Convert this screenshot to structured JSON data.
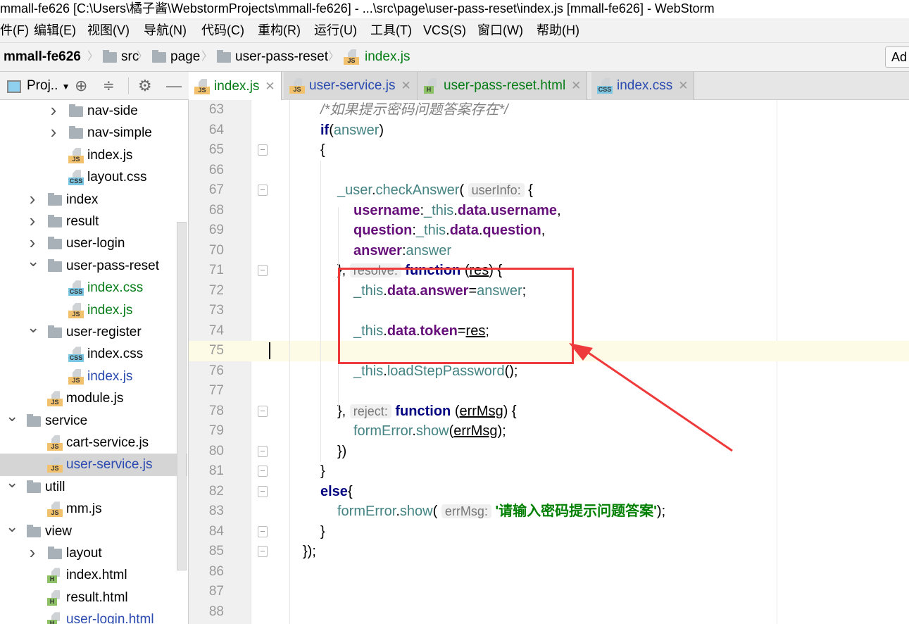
{
  "window": {
    "title": "mmall-fe626 [C:\\Users\\橘子酱\\WebstormProjects\\mmall-fe626] - ...\\src\\page\\user-pass-reset\\index.js [mmall-fe626] - WebStorm"
  },
  "menu": [
    "件(F)",
    "编辑(E)",
    "视图(V)",
    "导航(N)",
    "代码(C)",
    "重构(R)",
    "运行(U)",
    "工具(T)",
    "VCS(S)",
    "窗口(W)",
    "帮助(H)"
  ],
  "breadcrumb": {
    "project": "mmall-fe626",
    "items": [
      "src",
      "page",
      "user-pass-reset"
    ],
    "file": "index.js",
    "add_button": "Ad"
  },
  "project_panel": {
    "label": "Proj.."
  },
  "tabs": [
    {
      "label": "index.js",
      "type": "js",
      "color": "#067d17",
      "active": true
    },
    {
      "label": "user-service.js",
      "type": "js",
      "color": "#2a4ab0"
    },
    {
      "label": "user-pass-reset.html",
      "type": "html",
      "color": "#067d17"
    },
    {
      "label": "index.css",
      "type": "css",
      "color": "#2a4ab0"
    }
  ],
  "tree": [
    {
      "label": "nav-side",
      "kind": "folder",
      "level": 3,
      "state": "collapsed"
    },
    {
      "label": "nav-simple",
      "kind": "folder",
      "level": 3,
      "state": "collapsed"
    },
    {
      "label": "index.js",
      "kind": "js",
      "level": 3
    },
    {
      "label": "layout.css",
      "kind": "css",
      "level": 3
    },
    {
      "label": "index",
      "kind": "folder",
      "level": 2,
      "state": "collapsed"
    },
    {
      "label": "result",
      "kind": "folder",
      "level": 2,
      "state": "collapsed"
    },
    {
      "label": "user-login",
      "kind": "folder",
      "level": 2,
      "state": "collapsed"
    },
    {
      "label": "user-pass-reset",
      "kind": "folder",
      "level": 2,
      "state": "expanded"
    },
    {
      "label": "index.css",
      "kind": "css",
      "level": 3,
      "color": "#067d17"
    },
    {
      "label": "index.js",
      "kind": "js",
      "level": 3,
      "color": "#067d17"
    },
    {
      "label": "user-register",
      "kind": "folder",
      "level": 2,
      "state": "expanded"
    },
    {
      "label": "index.css",
      "kind": "css",
      "level": 3
    },
    {
      "label": "index.js",
      "kind": "js",
      "level": 3,
      "color": "#2a4ab0"
    },
    {
      "label": "module.js",
      "kind": "js",
      "level": 2
    },
    {
      "label": "service",
      "kind": "folder",
      "level": 1,
      "state": "expanded"
    },
    {
      "label": "cart-service.js",
      "kind": "js",
      "level": 2
    },
    {
      "label": "user-service.js",
      "kind": "js",
      "level": 2,
      "color": "#2a4ab0",
      "selected": true
    },
    {
      "label": "utill",
      "kind": "folder",
      "level": 1,
      "state": "expanded"
    },
    {
      "label": "mm.js",
      "kind": "js",
      "level": 2
    },
    {
      "label": "view",
      "kind": "folder",
      "level": 1,
      "state": "expanded"
    },
    {
      "label": "layout",
      "kind": "folder",
      "level": 2,
      "state": "collapsed"
    },
    {
      "label": "index.html",
      "kind": "html",
      "level": 2
    },
    {
      "label": "result.html",
      "kind": "html",
      "level": 2
    },
    {
      "label": "user-login.html",
      "kind": "html",
      "level": 2,
      "color": "#2a4ab0"
    }
  ],
  "editor": {
    "current_line": 75,
    "lines": [
      {
        "n": 63,
        "indent": 2,
        "tokens": [
          [
            "/*如果提示密码问题答案存在*/",
            "cm"
          ]
        ]
      },
      {
        "n": 64,
        "indent": 2,
        "tokens": [
          [
            "if",
            "kw"
          ],
          [
            "(",
            ""
          ],
          [
            "answer",
            "id"
          ],
          [
            ")",
            ""
          ]
        ]
      },
      {
        "n": 65,
        "indent": 2,
        "fold": true,
        "tokens": [
          [
            "{",
            ""
          ]
        ]
      },
      {
        "n": 66,
        "indent": 0,
        "tokens": []
      },
      {
        "n": 67,
        "indent": 3,
        "fold": true,
        "tokens": [
          [
            "_user",
            "id"
          ],
          [
            ".",
            ""
          ],
          [
            "checkAnswer",
            "fn"
          ],
          [
            "( ",
            ""
          ],
          [
            "userInfo:",
            "hint"
          ],
          [
            " {",
            ""
          ]
        ]
      },
      {
        "n": 68,
        "indent": 4,
        "tokens": [
          [
            "username",
            "pr"
          ],
          [
            ":",
            ""
          ],
          [
            "_this",
            "id"
          ],
          [
            ".",
            ""
          ],
          [
            "data",
            "pr"
          ],
          [
            ".",
            ""
          ],
          [
            "username",
            "pr"
          ],
          [
            ",",
            ""
          ]
        ]
      },
      {
        "n": 69,
        "indent": 4,
        "tokens": [
          [
            "question",
            "pr"
          ],
          [
            ":",
            ""
          ],
          [
            "_this",
            "id"
          ],
          [
            ".",
            ""
          ],
          [
            "data",
            "pr"
          ],
          [
            ".",
            ""
          ],
          [
            "question",
            "pr"
          ],
          [
            ",",
            ""
          ]
        ]
      },
      {
        "n": 70,
        "indent": 4,
        "tokens": [
          [
            "answer",
            "pr"
          ],
          [
            ":",
            ""
          ],
          [
            "answer",
            "id"
          ]
        ]
      },
      {
        "n": 71,
        "indent": 3,
        "fold": true,
        "tokens": [
          [
            "}, ",
            ""
          ],
          [
            "resolve:",
            "hint"
          ],
          [
            " ",
            ""
          ],
          [
            "function",
            "kw"
          ],
          [
            " (",
            ""
          ],
          [
            "res",
            "ul"
          ],
          [
            ") {",
            ""
          ]
        ]
      },
      {
        "n": 72,
        "indent": 4,
        "tokens": [
          [
            "_this",
            "id"
          ],
          [
            ".",
            ""
          ],
          [
            "data",
            "pr"
          ],
          [
            ".",
            ""
          ],
          [
            "answer",
            "pr"
          ],
          [
            "=",
            ""
          ],
          [
            "answer",
            "id"
          ],
          [
            ";",
            ""
          ]
        ]
      },
      {
        "n": 73,
        "indent": 0,
        "tokens": []
      },
      {
        "n": 74,
        "indent": 4,
        "tokens": [
          [
            "_this",
            "id"
          ],
          [
            ".",
            ""
          ],
          [
            "data",
            "pr"
          ],
          [
            ".",
            ""
          ],
          [
            "token",
            "pr"
          ],
          [
            "=",
            ""
          ],
          [
            "res",
            "ul"
          ],
          [
            ";",
            ""
          ]
        ]
      },
      {
        "n": 75,
        "indent": 0,
        "tokens": []
      },
      {
        "n": 76,
        "indent": 4,
        "tokens": [
          [
            "_this",
            "id"
          ],
          [
            ".",
            ""
          ],
          [
            "loadStepPassword",
            "fn"
          ],
          [
            "();",
            ""
          ]
        ]
      },
      {
        "n": 77,
        "indent": 0,
        "tokens": []
      },
      {
        "n": 78,
        "indent": 3,
        "fold": true,
        "tokens": [
          [
            "}, ",
            ""
          ],
          [
            "reject:",
            "hint"
          ],
          [
            " ",
            ""
          ],
          [
            "function",
            "kw"
          ],
          [
            " (",
            ""
          ],
          [
            "errMsg",
            "ul"
          ],
          [
            ") {",
            ""
          ]
        ]
      },
      {
        "n": 79,
        "indent": 4,
        "tokens": [
          [
            "formError",
            "id"
          ],
          [
            ".",
            ""
          ],
          [
            "show",
            "fn"
          ],
          [
            "(",
            ""
          ],
          [
            "errMsg",
            "ul"
          ],
          [
            ");",
            ""
          ]
        ]
      },
      {
        "n": 80,
        "indent": 3,
        "fold": true,
        "tokens": [
          [
            "})",
            ""
          ]
        ]
      },
      {
        "n": 81,
        "indent": 2,
        "fold": true,
        "tokens": [
          [
            "}",
            ""
          ]
        ]
      },
      {
        "n": 82,
        "indent": 2,
        "fold": true,
        "tokens": [
          [
            "else",
            "kw"
          ],
          [
            "{",
            ""
          ]
        ]
      },
      {
        "n": 83,
        "indent": 3,
        "tokens": [
          [
            "formError",
            "id"
          ],
          [
            ".",
            ""
          ],
          [
            "show",
            "fn"
          ],
          [
            "( ",
            ""
          ],
          [
            "errMsg:",
            "hint"
          ],
          [
            " ",
            ""
          ],
          [
            "'请输入密码提示问题答案'",
            "st"
          ],
          [
            ");",
            ""
          ]
        ]
      },
      {
        "n": 84,
        "indent": 2,
        "fold": true,
        "tokens": [
          [
            "}",
            ""
          ]
        ]
      },
      {
        "n": 85,
        "indent": 1,
        "fold": true,
        "tokens": [
          [
            "});",
            ""
          ]
        ]
      },
      {
        "n": 86,
        "indent": 0,
        "tokens": []
      },
      {
        "n": 87,
        "indent": 0,
        "tokens": []
      },
      {
        "n": 88,
        "indent": 0,
        "tokens": []
      }
    ]
  },
  "annotation": {
    "color": "#ee3a3a"
  }
}
